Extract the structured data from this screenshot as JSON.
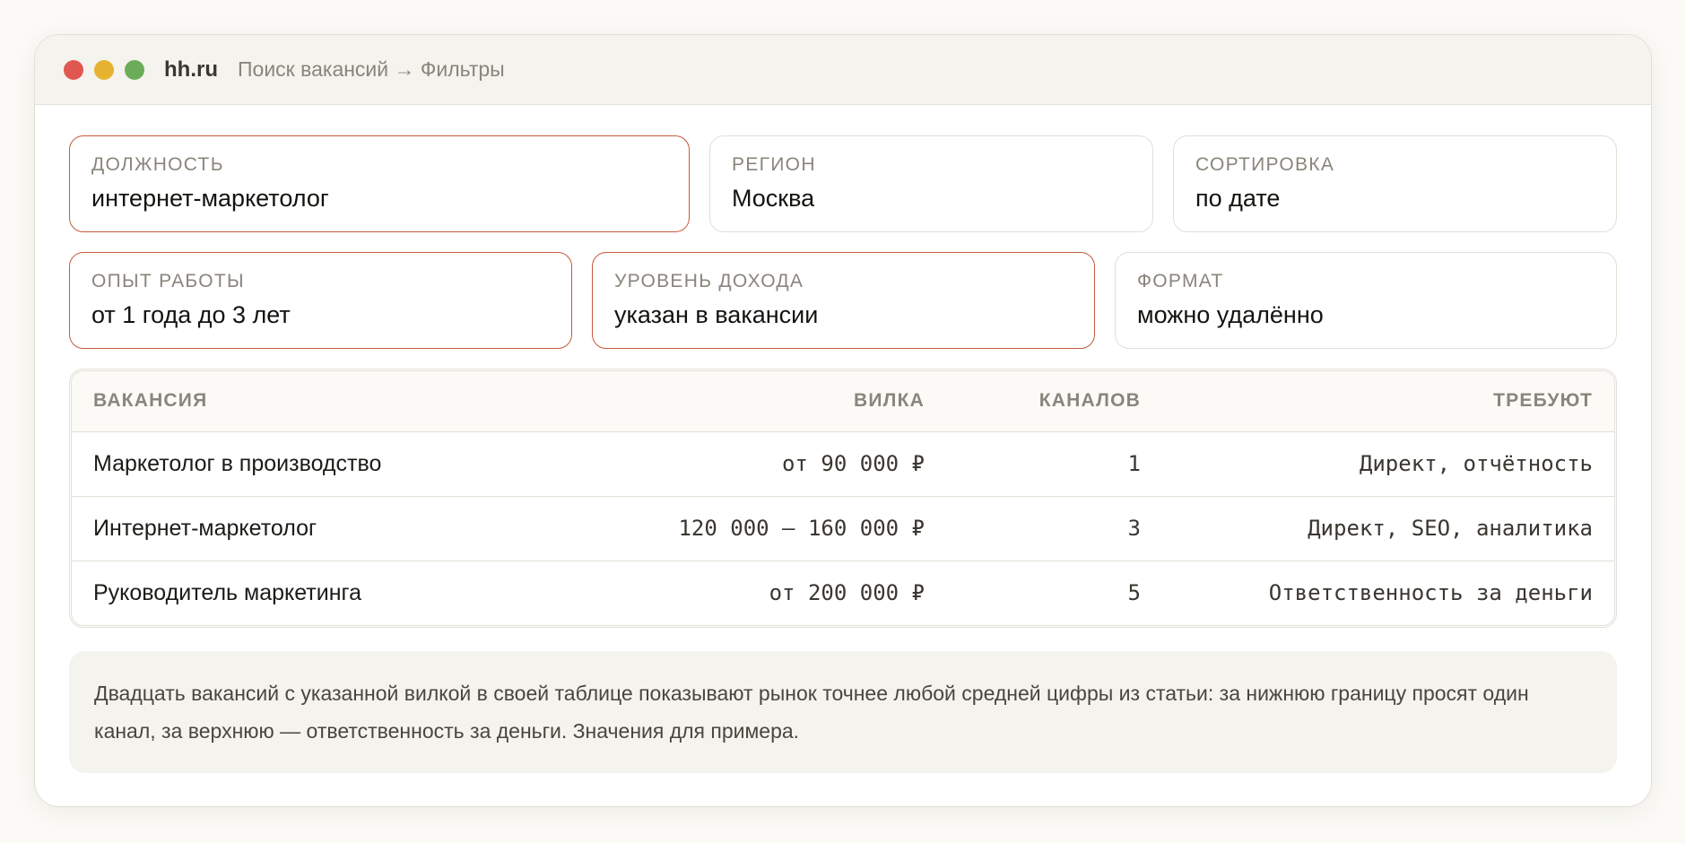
{
  "titlebar": {
    "site": "hh.ru",
    "breadcrumb": "Поиск вакансий → Фильтры"
  },
  "filters": {
    "row1": [
      {
        "label": "Должность",
        "value": "интернет-маркетолог",
        "active": true
      },
      {
        "label": "Регион",
        "value": "Москва",
        "active": false
      },
      {
        "label": "Сортировка",
        "value": "по дате",
        "active": false
      }
    ],
    "row2": [
      {
        "label": "Опыт работы",
        "value": "от 1 года до 3 лет",
        "active": true
      },
      {
        "label": "Уровень дохода",
        "value": "указан в вакансии",
        "active": true
      },
      {
        "label": "Формат",
        "value": "можно удалённо",
        "active": false
      }
    ]
  },
  "table": {
    "headers": [
      "Вакансия",
      "Вилка",
      "Каналов",
      "Требуют"
    ],
    "rows": [
      [
        "Маркетолог в производство",
        "от 90 000 ₽",
        "1",
        "Директ, отчётность"
      ],
      [
        "Интернет-маркетолог",
        "120 000 – 160 000 ₽",
        "3",
        "Директ, SEO, аналитика"
      ],
      [
        "Руководитель маркетинга",
        "от 200 000 ₽",
        "5",
        "Ответственность за деньги"
      ]
    ]
  },
  "note": "Двадцать вакансий с указанной вилкой в своей таблице показывают рынок точнее любой средней цифры из статьи: за нижнюю границу просят один канал, за верхнюю — ответственность за деньги. Значения для примера.",
  "colors": {
    "active_border": "#c45a3e",
    "dot_red": "#e0574f",
    "dot_yellow": "#e6b331",
    "dot_green": "#6aac5a"
  }
}
